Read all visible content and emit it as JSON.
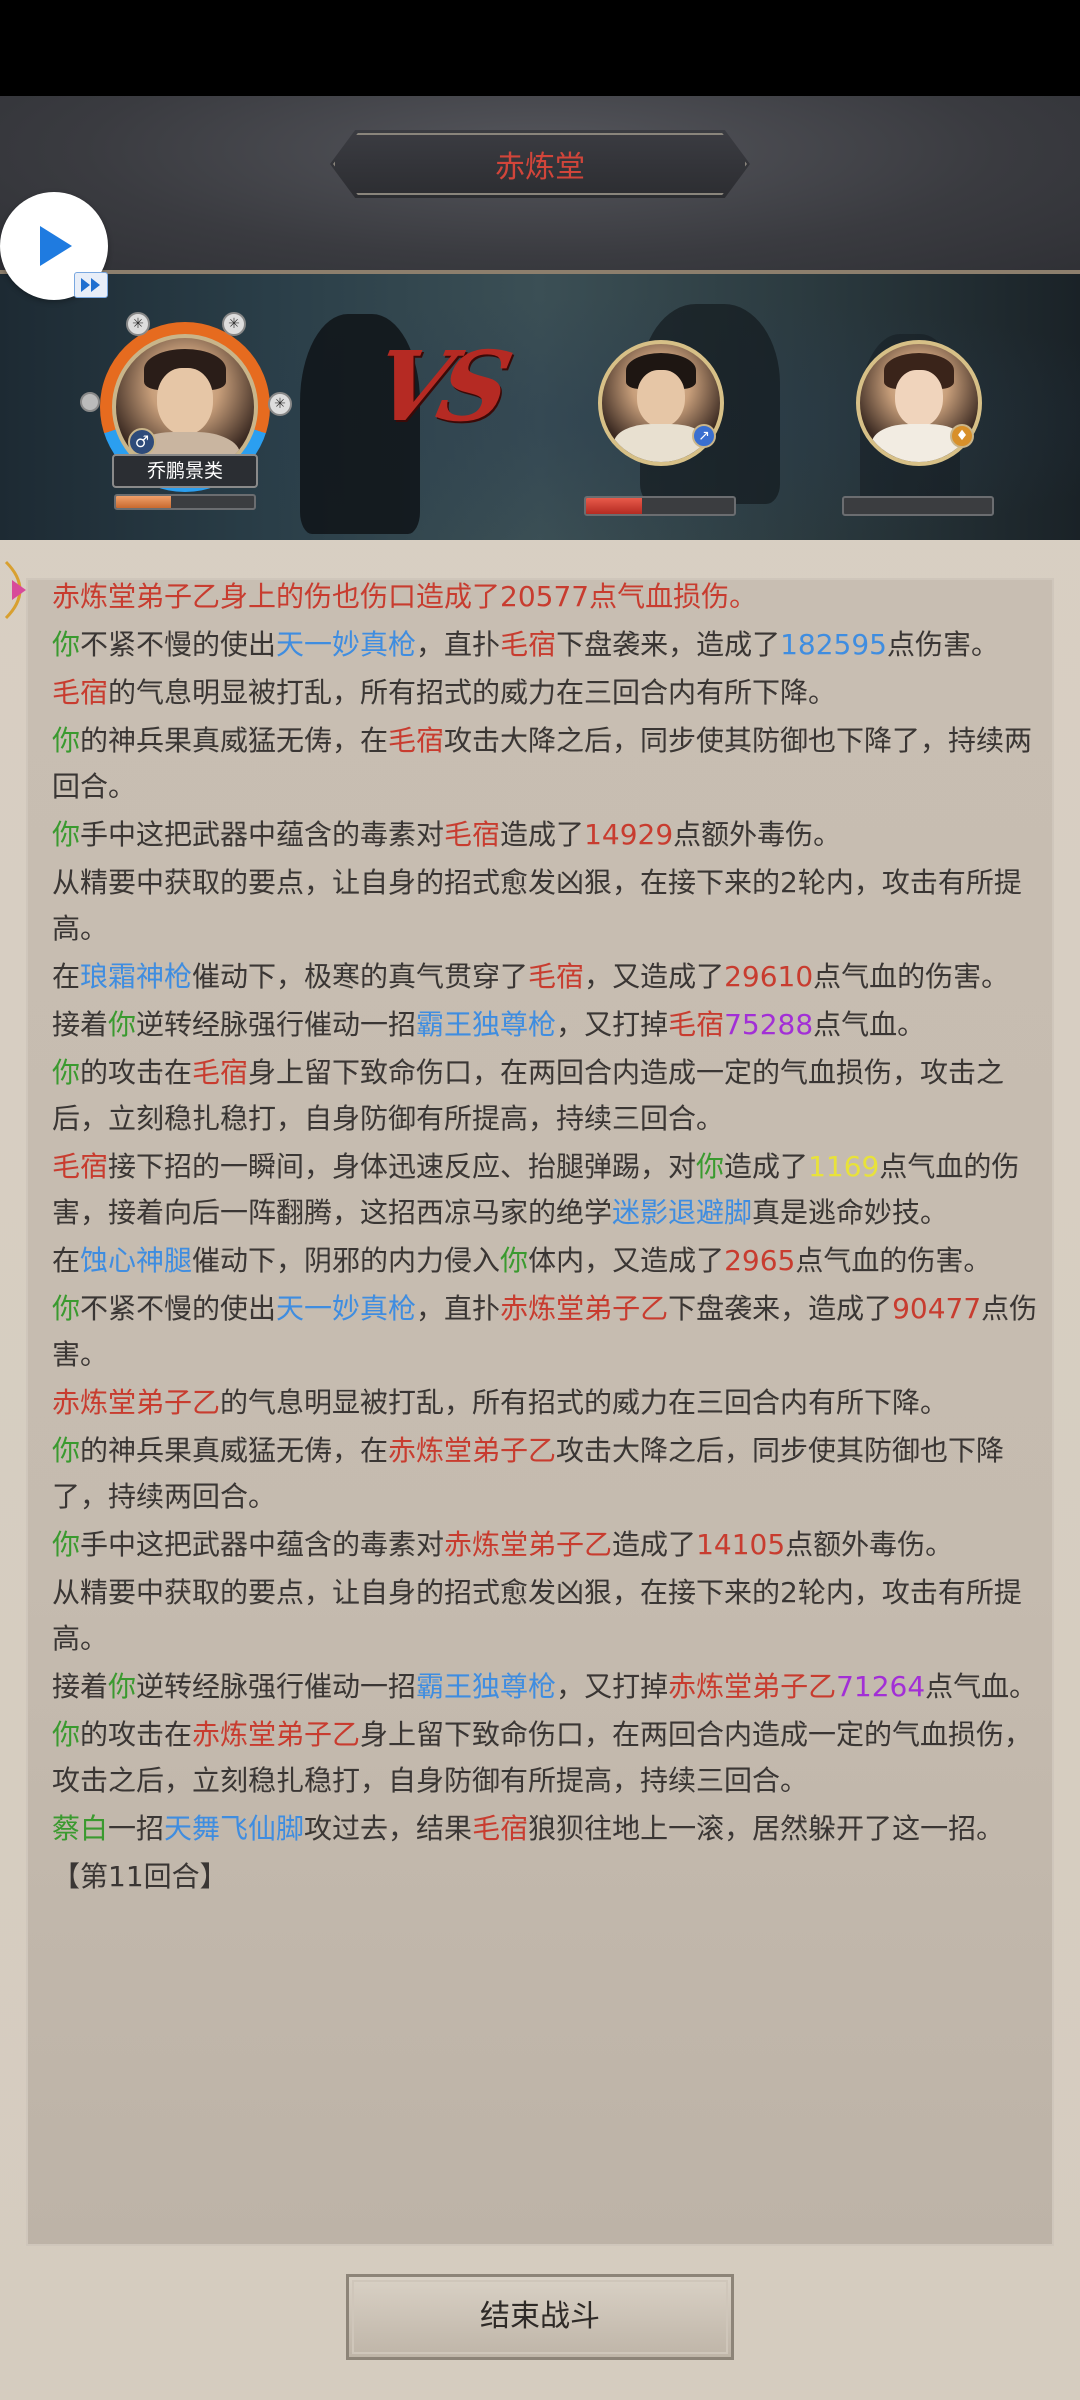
{
  "header": {
    "title": "赤炼堂"
  },
  "player": {
    "name": "乔鹏景类",
    "hp_fraction": 0.4
  },
  "enemies": [
    {
      "name": "毛宿",
      "hp_fraction": 0.38
    },
    {
      "name": "赤炼堂弟子乙",
      "hp_fraction": 0.0
    }
  ],
  "log": [
    {
      "segments": [
        {
          "t": "赤炼堂弟子乙身上的伤也伤口造成了20577点气血损伤。",
          "c": "partial"
        }
      ]
    },
    {
      "segments": [
        {
          "t": "你",
          "c": "g"
        },
        {
          "t": "不紧不慢的使出",
          "c": ""
        },
        {
          "t": "天一妙真枪",
          "c": "b"
        },
        {
          "t": "，直扑",
          "c": ""
        },
        {
          "t": "毛宿",
          "c": "r"
        },
        {
          "t": "下盘袭来，造成了",
          "c": ""
        },
        {
          "t": "182595",
          "c": "b"
        },
        {
          "t": "点伤害。",
          "c": ""
        }
      ]
    },
    {
      "segments": [
        {
          "t": "毛宿",
          "c": "r"
        },
        {
          "t": "的气息明显被打乱，所有招式的威力在三回合内有所下降。",
          "c": ""
        }
      ]
    },
    {
      "segments": [
        {
          "t": "你",
          "c": "g"
        },
        {
          "t": "的神兵果真威猛无俦，在",
          "c": ""
        },
        {
          "t": "毛宿",
          "c": "r"
        },
        {
          "t": "攻击大降之后，同步使其防御也下降了，持续两回合。",
          "c": ""
        }
      ]
    },
    {
      "segments": [
        {
          "t": "你",
          "c": "g"
        },
        {
          "t": "手中这把武器中蕴含的毒素对",
          "c": ""
        },
        {
          "t": "毛宿",
          "c": "r"
        },
        {
          "t": "造成了",
          "c": ""
        },
        {
          "t": "14929",
          "c": "r"
        },
        {
          "t": "点额外毒伤。",
          "c": ""
        }
      ]
    },
    {
      "segments": [
        {
          "t": "从精要中获取的要点，让自身的招式愈发凶狠，在接下来的2轮内，攻击有所提高。",
          "c": ""
        }
      ]
    },
    {
      "segments": [
        {
          "t": "在",
          "c": ""
        },
        {
          "t": "琅霜神枪",
          "c": "b"
        },
        {
          "t": "催动下，极寒的真气贯穿了",
          "c": ""
        },
        {
          "t": "毛宿",
          "c": "r"
        },
        {
          "t": "，又造成了",
          "c": ""
        },
        {
          "t": "29610",
          "c": "r"
        },
        {
          "t": "点气血的伤害。",
          "c": ""
        }
      ]
    },
    {
      "segments": [
        {
          "t": "接着",
          "c": ""
        },
        {
          "t": "你",
          "c": "g"
        },
        {
          "t": "逆转经脉强行催动一招",
          "c": ""
        },
        {
          "t": "霸王独尊枪",
          "c": "b"
        },
        {
          "t": "，又打掉",
          "c": ""
        },
        {
          "t": "毛宿",
          "c": "r"
        },
        {
          "t": "75288",
          "c": "p"
        },
        {
          "t": "点气血。",
          "c": ""
        }
      ]
    },
    {
      "segments": [
        {
          "t": "你",
          "c": "g"
        },
        {
          "t": "的攻击在",
          "c": ""
        },
        {
          "t": "毛宿",
          "c": "r"
        },
        {
          "t": "身上留下致命伤口，在两回合内造成一定的气血损伤，攻击之后，立刻稳扎稳打，自身防御有所提高，持续三回合。",
          "c": ""
        }
      ]
    },
    {
      "segments": [
        {
          "t": "毛宿",
          "c": "r"
        },
        {
          "t": "接下招的一瞬间，身体迅速反应、抬腿弹踢，对",
          "c": ""
        },
        {
          "t": "你",
          "c": "g"
        },
        {
          "t": "造成了",
          "c": ""
        },
        {
          "t": "1169",
          "c": "y"
        },
        {
          "t": "点气血的伤害，接着向后一阵翻腾，这招西凉马家的绝学",
          "c": ""
        },
        {
          "t": "迷影退避脚",
          "c": "b"
        },
        {
          "t": "真是逃命妙技。",
          "c": ""
        }
      ]
    },
    {
      "segments": [
        {
          "t": "在",
          "c": ""
        },
        {
          "t": "蚀心神腿",
          "c": "b"
        },
        {
          "t": "催动下，阴邪的内力侵入",
          "c": ""
        },
        {
          "t": "你",
          "c": "g"
        },
        {
          "t": "体内，又造成了",
          "c": ""
        },
        {
          "t": "2965",
          "c": "r"
        },
        {
          "t": "点气血的伤害。",
          "c": ""
        }
      ]
    },
    {
      "segments": [
        {
          "t": "你",
          "c": "g"
        },
        {
          "t": "不紧不慢的使出",
          "c": ""
        },
        {
          "t": "天一妙真枪",
          "c": "b"
        },
        {
          "t": "，直扑",
          "c": ""
        },
        {
          "t": "赤炼堂弟子乙",
          "c": "r"
        },
        {
          "t": "下盘袭来，造成了",
          "c": ""
        },
        {
          "t": "90477",
          "c": "r"
        },
        {
          "t": "点伤害。",
          "c": ""
        }
      ]
    },
    {
      "segments": [
        {
          "t": "赤炼堂弟子乙",
          "c": "r"
        },
        {
          "t": "的气息明显被打乱，所有招式的威力在三回合内有所下降。",
          "c": ""
        }
      ]
    },
    {
      "segments": [
        {
          "t": "你",
          "c": "g"
        },
        {
          "t": "的神兵果真威猛无俦，在",
          "c": ""
        },
        {
          "t": "赤炼堂弟子乙",
          "c": "r"
        },
        {
          "t": "攻击大降之后，同步使其防御也下降了，持续两回合。",
          "c": ""
        }
      ]
    },
    {
      "segments": [
        {
          "t": "你",
          "c": "g"
        },
        {
          "t": "手中这把武器中蕴含的毒素对",
          "c": ""
        },
        {
          "t": "赤炼堂弟子乙",
          "c": "r"
        },
        {
          "t": "造成了",
          "c": ""
        },
        {
          "t": "14105",
          "c": "r"
        },
        {
          "t": "点额外毒伤。",
          "c": ""
        }
      ]
    },
    {
      "segments": [
        {
          "t": "从精要中获取的要点，让自身的招式愈发凶狠，在接下来的2轮内，攻击有所提高。",
          "c": ""
        }
      ]
    },
    {
      "segments": [
        {
          "t": "接着",
          "c": ""
        },
        {
          "t": "你",
          "c": "g"
        },
        {
          "t": "逆转经脉强行催动一招",
          "c": ""
        },
        {
          "t": "霸王独尊枪",
          "c": "b"
        },
        {
          "t": "，又打掉",
          "c": ""
        },
        {
          "t": "赤炼堂弟子乙",
          "c": "r"
        },
        {
          "t": "71264",
          "c": "p"
        },
        {
          "t": "点气血。",
          "c": ""
        }
      ]
    },
    {
      "segments": [
        {
          "t": "你",
          "c": "g"
        },
        {
          "t": "的攻击在",
          "c": ""
        },
        {
          "t": "赤炼堂弟子乙",
          "c": "r"
        },
        {
          "t": "身上留下致命伤口，在两回合内造成一定的气血损伤，攻击之后，立刻稳扎稳打，自身防御有所提高，持续三回合。",
          "c": ""
        }
      ]
    },
    {
      "segments": [
        {
          "t": "蔡白",
          "c": "g"
        },
        {
          "t": "一招",
          "c": ""
        },
        {
          "t": "天舞飞仙脚",
          "c": "b"
        },
        {
          "t": "攻过去，结果",
          "c": ""
        },
        {
          "t": "毛宿",
          "c": "r"
        },
        {
          "t": "狼狈往地上一滚，居然躲开了这一招。",
          "c": ""
        }
      ]
    },
    {
      "segments": [
        {
          "t": "【第11回合】",
          "c": ""
        }
      ]
    }
  ],
  "footer": {
    "end_battle_label": "结束战斗"
  },
  "colors": {
    "player_name": "#3a9a2f",
    "enemy_name": "#c83c2f",
    "skill_name": "#3f8de0",
    "damage_taken": "#e8e23a",
    "heavy_damage": "#a22fd6"
  }
}
